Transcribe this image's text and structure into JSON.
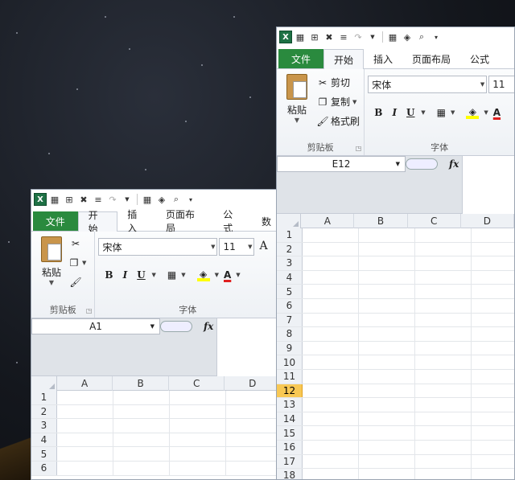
{
  "left_window": {
    "tabs": [
      {
        "label": "文件"
      },
      {
        "label": "开始"
      },
      {
        "label": "插入"
      },
      {
        "label": "页面布局"
      },
      {
        "label": "公式"
      },
      {
        "label": "数"
      }
    ],
    "clipboard": {
      "paste_label": "粘贴",
      "group_label": "剪贴板"
    },
    "font": {
      "name": "宋体",
      "size": "11",
      "group_label": "字体",
      "grow_glyph": "A"
    },
    "name_box": "A1",
    "fx_label": "fx",
    "columns": [
      "A",
      "B",
      "C",
      "D"
    ],
    "rows": [
      "1",
      "2",
      "3",
      "4",
      "5",
      "6"
    ]
  },
  "right_window": {
    "tabs": [
      {
        "label": "文件"
      },
      {
        "label": "开始"
      },
      {
        "label": "插入"
      },
      {
        "label": "页面布局"
      },
      {
        "label": "公式"
      }
    ],
    "clipboard": {
      "paste_label": "粘贴",
      "cut_label": "剪切",
      "copy_label": "复制",
      "format_painter_label": "格式刷",
      "group_label": "剪贴板"
    },
    "font": {
      "name": "宋体",
      "size": "11",
      "group_label": "字体"
    },
    "name_box": "E12",
    "fx_label": "fx",
    "columns": [
      "A",
      "B",
      "C",
      "D"
    ],
    "rows": [
      "1",
      "2",
      "3",
      "4",
      "5",
      "6",
      "7",
      "8",
      "9",
      "10",
      "11",
      "12",
      "13",
      "14",
      "15",
      "16",
      "17",
      "18"
    ],
    "selected_row": "12"
  },
  "format_buttons": {
    "bold": "B",
    "italic": "I",
    "underline": "U",
    "font_color": "A"
  },
  "colors": {
    "file_tab": "#2a8a3e",
    "selected_row": "#f8c854",
    "fill_color": "#ffff00",
    "font_color": "#e02020"
  }
}
